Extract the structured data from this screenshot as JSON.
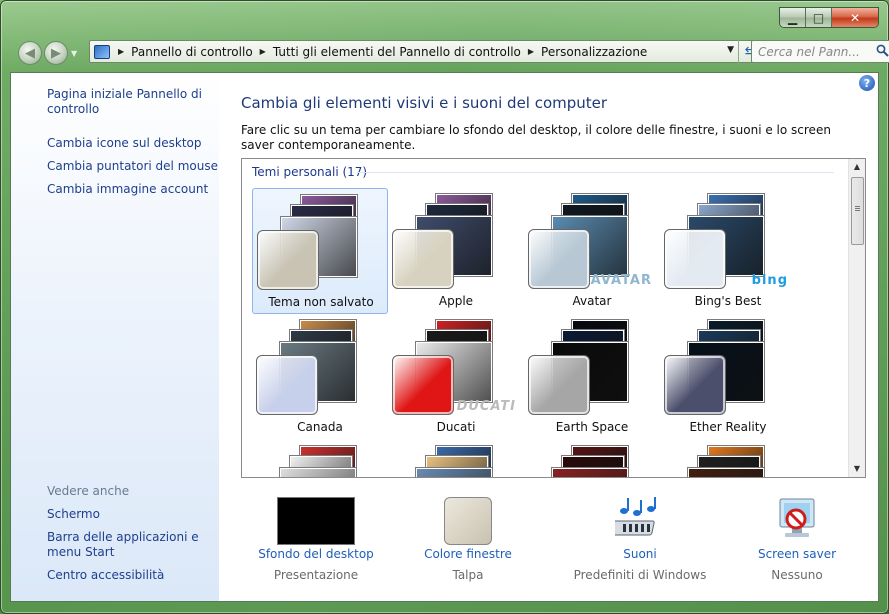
{
  "window": {
    "caption_min": "▁",
    "caption_max": "□",
    "caption_close": "✕"
  },
  "nav": {
    "back_glyph": "◀",
    "forward_glyph": "▶",
    "breadcrumbs": [
      "Pannello di controllo",
      "Tutti gli elementi del Pannello di controllo",
      "Personalizzazione"
    ],
    "search_placeholder": "Cerca nel Pann..."
  },
  "sidebar": {
    "links": [
      "Pagina iniziale Pannello di controllo",
      "Cambia icone sul desktop",
      "Cambia puntatori del mouse",
      "Cambia immagine account"
    ],
    "see_also_heading": "Vedere anche",
    "see_also": [
      "Schermo",
      "Barra delle applicazioni e menu Start",
      "Centro accessibilità"
    ]
  },
  "main": {
    "title": "Cambia gli elementi visivi e i suoni del computer",
    "description": "Fare clic su un tema per cambiare lo sfondo del desktop, il colore delle finestre, i suoni e lo screen saver contemporaneamente.",
    "group_header": "Temi personali (17)",
    "themes": [
      {
        "label": "Tema non salvato",
        "selected": true,
        "window_color": "#c8c3b3",
        "wall_colors": [
          "#8b5a9b",
          "#2b2b48",
          "#cfd6e6"
        ],
        "logo": ""
      },
      {
        "label": "Apple",
        "selected": false,
        "window_color": "#d7d2bf",
        "wall_colors": [
          "#8b5a9b",
          "#1e2a3e",
          "#3f4c6c"
        ],
        "logo": ""
      },
      {
        "label": "Avatar",
        "selected": false,
        "window_color": "#b7c8d4",
        "wall_colors": [
          "#1f5a8a",
          "#101820",
          "#5a8bb0"
        ],
        "logo": "AVATAR"
      },
      {
        "label": "Bing's Best",
        "selected": false,
        "window_color": "#e3eaf1",
        "wall_colors": [
          "#3a6fb2",
          "#8aa6cc",
          "#2a4a6a"
        ],
        "logo": "bing"
      },
      {
        "label": "Canada",
        "selected": false,
        "window_color": "#c7d0ea",
        "wall_colors": [
          "#c98b4a",
          "#2e3a46",
          "#6a7a82"
        ],
        "logo": ""
      },
      {
        "label": "Ducati",
        "selected": false,
        "window_color": "#e01515",
        "wall_colors": [
          "#cc2222",
          "#1a1a1a",
          "#eaeaea"
        ],
        "logo": "DUCATI"
      },
      {
        "label": "Earth Space",
        "selected": false,
        "window_color": "#a6a6a6",
        "wall_colors": [
          "#050810",
          "#0a1a35",
          "#0a0a0a"
        ],
        "logo": ""
      },
      {
        "label": "Ether Reality",
        "selected": false,
        "window_color": "#4b4f6c",
        "wall_colors": [
          "#0a1a2a",
          "#1a3a5a",
          "#05101a"
        ],
        "logo": ""
      },
      {
        "label": "",
        "selected": false,
        "window_color": "",
        "wall_colors": [
          "#cc3030",
          "#f0f0f0",
          "#dedede"
        ],
        "logo": ""
      },
      {
        "label": "",
        "selected": false,
        "window_color": "",
        "wall_colors": [
          "#3a6aa8",
          "#e8c080",
          "#6a8ab0"
        ],
        "logo": ""
      },
      {
        "label": "",
        "selected": false,
        "window_color": "",
        "wall_colors": [
          "#551515",
          "#2a0a0a",
          "#882222"
        ],
        "logo": ""
      },
      {
        "label": "",
        "selected": false,
        "window_color": "",
        "wall_colors": [
          "#e07820",
          "#202020",
          "#402010"
        ],
        "logo": ""
      }
    ]
  },
  "settings": [
    {
      "label": "Sfondo del desktop",
      "value": "Presentazione"
    },
    {
      "label": "Colore finestre",
      "value": "Talpa"
    },
    {
      "label": "Suoni",
      "value": "Predefiniti di Windows"
    },
    {
      "label": "Screen saver",
      "value": "Nessuno"
    }
  ],
  "colors": {
    "link": "#1e3f8c",
    "title": "#1e3a78",
    "setting_link": "#1e5fb8"
  }
}
